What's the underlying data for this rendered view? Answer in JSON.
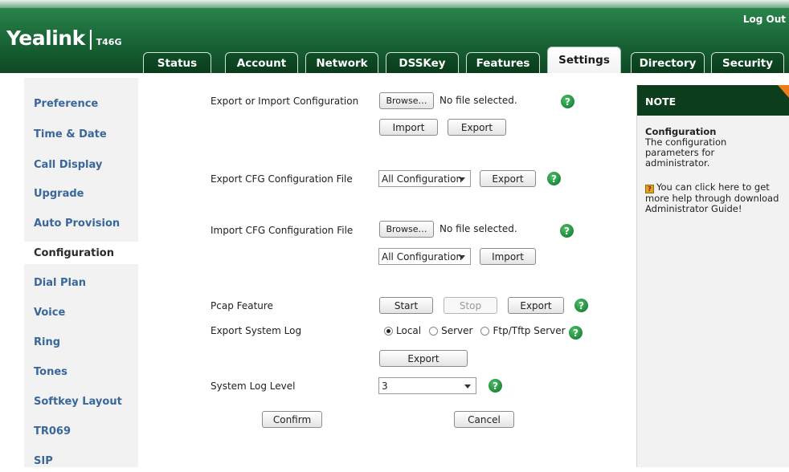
{
  "header": {
    "brand": "Yealink",
    "model": "T46G",
    "logout": "Log Out",
    "tabs": [
      "Status",
      "Account",
      "Network",
      "DSSKey",
      "Features",
      "Settings",
      "Directory",
      "Security"
    ],
    "active_tab": "Settings"
  },
  "sidebar": {
    "items": [
      "Preference",
      "Time & Date",
      "Call Display",
      "Upgrade",
      "Auto Provision",
      "Configuration",
      "Dial Plan",
      "Voice",
      "Ring",
      "Tones",
      "Softkey Layout",
      "TR069",
      "SIP"
    ],
    "active": "Configuration"
  },
  "main": {
    "export_import": {
      "label": "Export or Import Configuration",
      "browse": "Browse…",
      "file_status": "No file selected.",
      "import": "Import",
      "export": "Export"
    },
    "export_cfg": {
      "label": "Export CFG Configuration File",
      "select_value": "All Configuration",
      "export": "Export"
    },
    "import_cfg": {
      "label": "Import CFG Configuration File",
      "browse": "Browse…",
      "file_status": "No file selected.",
      "select_value": "All Configuration",
      "import": "Import"
    },
    "pcap": {
      "label": "Pcap Feature",
      "start": "Start",
      "stop": "Stop",
      "export": "Export"
    },
    "system_log": {
      "label": "Export System Log",
      "options": [
        "Local",
        "Server",
        "Ftp/Tftp Server"
      ],
      "selected": "Local",
      "export": "Export"
    },
    "log_level": {
      "label": "System Log Level",
      "value": "3"
    },
    "confirm": "Confirm",
    "cancel": "Cancel",
    "help_glyph": "?"
  },
  "note": {
    "title": "NOTE",
    "heading": "Configuration",
    "text": "The configuration parameters for administrator.",
    "tip": "You can click here to get more help through download Administrator Guide!"
  },
  "colors": {
    "header_green": "#1c6a3a",
    "tab_dark": "#0f4e26",
    "sidebar_link": "#39679a",
    "note_header": "#0c3d1c",
    "note_accent": "#ee7c1a",
    "help_green": "#1d8a3a"
  }
}
